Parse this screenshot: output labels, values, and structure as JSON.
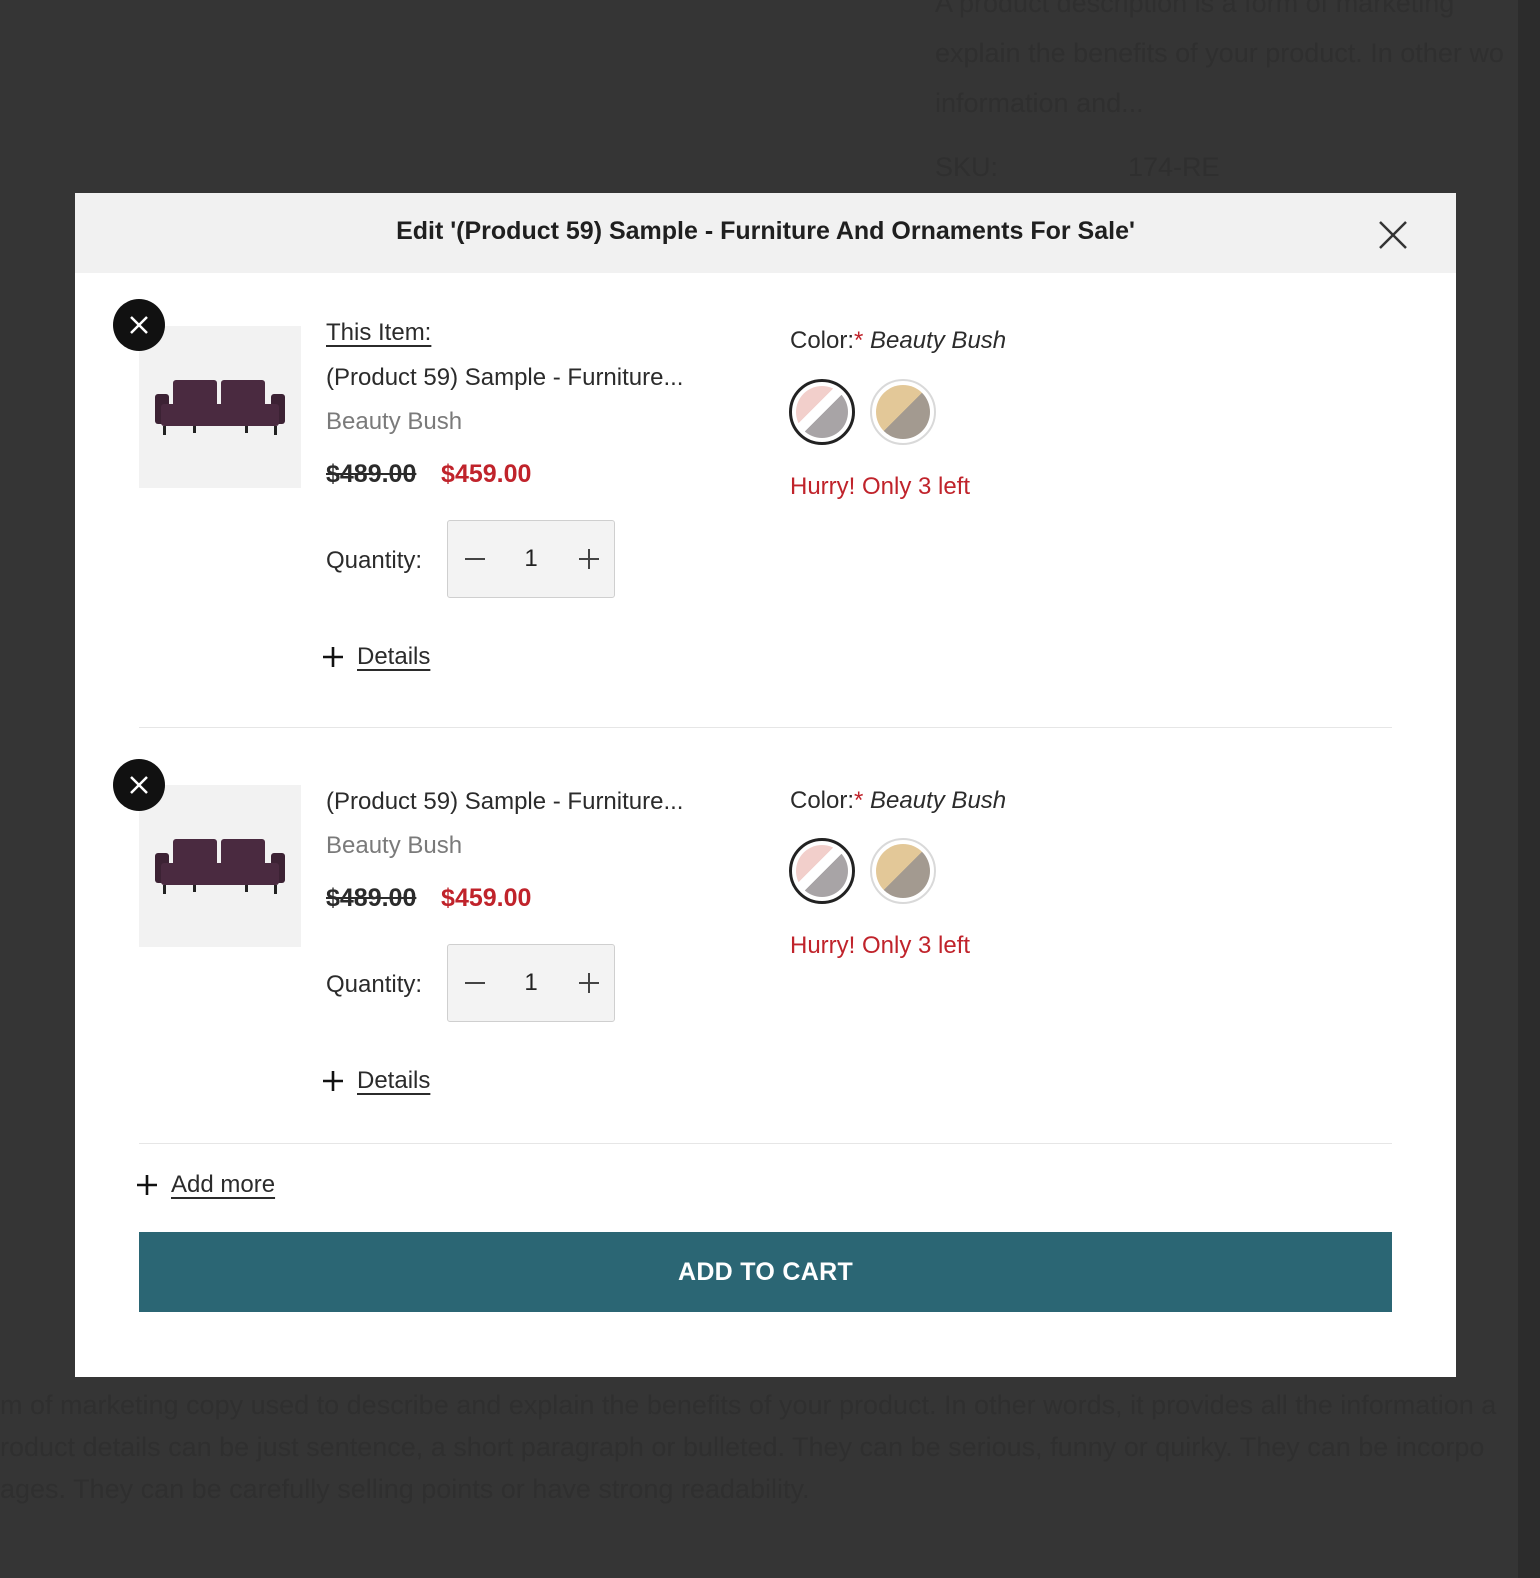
{
  "background": {
    "lines": [
      "A product description is a form of marketing",
      "explain the benefits of your product. In other wo",
      "information and...",
      "SKU:",
      "174-RE",
      "m of marketing copy used to describe and explain the benefits of your product. In other words, it provides all the information a",
      "roduct details can be just sentence, a short paragraph or bulleted. They can be serious, funny or quirky. They can be incorpo",
      "ages. They can be carefully selling points or have strong readability."
    ]
  },
  "modal": {
    "title": "Edit '(Product 59) Sample - Furniture And Ornaments For Sale'",
    "close_icon": "close-icon"
  },
  "items": [
    {
      "this_item_label": "This Item:",
      "name": "(Product 59) Sample - Furniture...",
      "variant": "Beauty Bush",
      "price_old": "$489.00",
      "price_new": "$459.00",
      "quantity_label": "Quantity:",
      "quantity": "1",
      "details_label": "Details",
      "color_label": "Color:",
      "required_mark": "*",
      "color_value": "Beauty Bush",
      "stock_text": "Hurry! Only 3 left"
    },
    {
      "this_item_label": "",
      "name": "(Product 59) Sample - Furniture...",
      "variant": "Beauty Bush",
      "price_old": "$489.00",
      "price_new": "$459.00",
      "quantity_label": "Quantity:",
      "quantity": "1",
      "details_label": "Details",
      "color_label": "Color:",
      "required_mark": "*",
      "color_value": "Beauty Bush",
      "stock_text": "Hurry! Only 3 left"
    }
  ],
  "swatches": [
    {
      "name": "beauty-bush",
      "colors": [
        "#f2cfcb",
        "#ffffff",
        "#a8a4a6"
      ],
      "selected": true
    },
    {
      "name": "tan",
      "colors": [
        "#e3c898",
        "#a39a90"
      ],
      "selected": false
    }
  ],
  "add_more_label": "Add more",
  "add_to_cart_label": "ADD TO CART",
  "colors": {
    "accent": "#2b6674",
    "sale": "#c0232b",
    "overlay": "#353535"
  }
}
